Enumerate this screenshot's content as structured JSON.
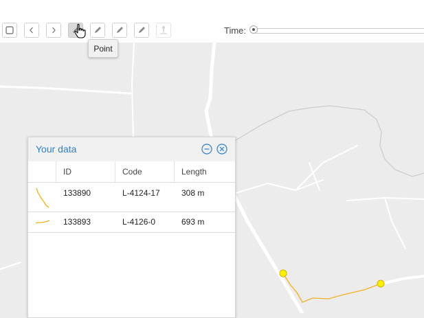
{
  "toolbar": {
    "buttons": [
      {
        "name": "select-tool-button",
        "icon": "square-icon",
        "state": "normal"
      },
      {
        "name": "back-button",
        "icon": "chevron-left-icon",
        "state": "normal"
      },
      {
        "name": "forward-button",
        "icon": "chevron-right-icon",
        "state": "normal"
      },
      {
        "name": "point-tool-button",
        "icon": "pencil-icon",
        "state": "active"
      },
      {
        "name": "line-tool-button",
        "icon": "pencil-icon",
        "state": "normal"
      },
      {
        "name": "polygon-tool-button",
        "icon": "pencil-icon",
        "state": "normal"
      },
      {
        "name": "edit-tool-button",
        "icon": "pencil-icon",
        "state": "normal"
      },
      {
        "name": "pin-tool-button",
        "icon": "pin-icon",
        "state": "disabled"
      }
    ],
    "tooltip": "Point",
    "time_label": "Time:"
  },
  "data_panel": {
    "title": "Your data",
    "columns": [
      "ID",
      "Code",
      "Length"
    ],
    "rows": [
      {
        "id": "133890",
        "code": "L-4124-17",
        "length": "308 m"
      },
      {
        "id": "133893",
        "code": "L-4126-0",
        "length": "693 m"
      }
    ]
  },
  "colors": {
    "map_background": "#ececec",
    "road": "#ffffff",
    "track": "#f2b01e",
    "node": "#ffef00",
    "accent": "#2f7fc1"
  }
}
